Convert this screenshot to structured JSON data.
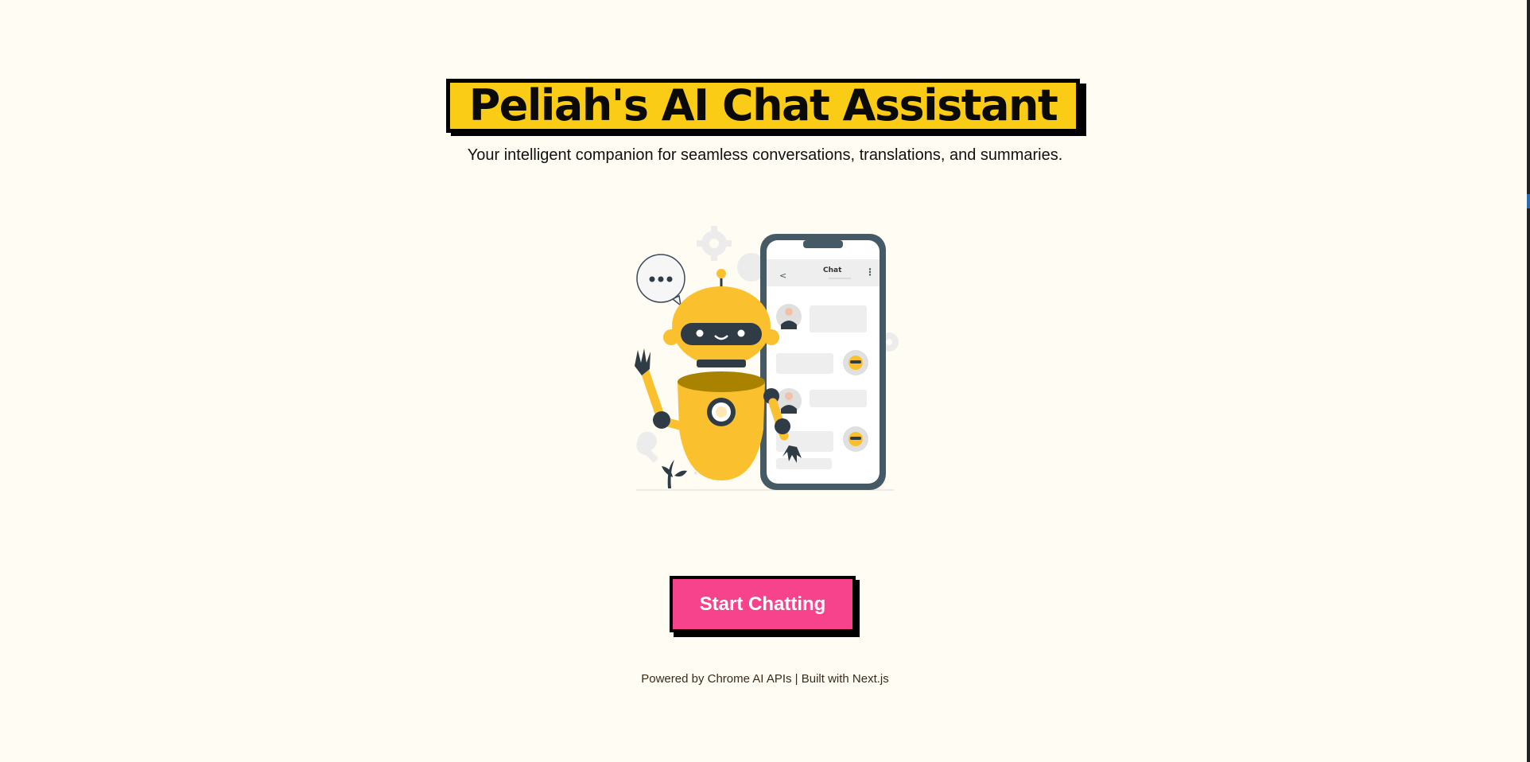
{
  "hero": {
    "title": "Peliah's AI Chat Assistant",
    "subtitle": "Your intelligent companion for seamless conversations, translations, and summaries."
  },
  "illustration": {
    "phone_header": "Chat",
    "back_glyph": "<",
    "menu_glyph": "⋮",
    "speech_bubble": "•••"
  },
  "cta": {
    "label": "Start Chatting"
  },
  "footer": {
    "text": "Powered by Chrome AI APIs | Built with Next.js"
  },
  "colors": {
    "background": "#fffcf3",
    "title_highlight": "#facc15",
    "button": "#f6438c",
    "robot": "#fbc02d"
  },
  "icons": [
    "robot-icon",
    "phone-icon",
    "speech-bubble-icon",
    "gear-icon",
    "plant-icon",
    "question-mark-icon"
  ]
}
